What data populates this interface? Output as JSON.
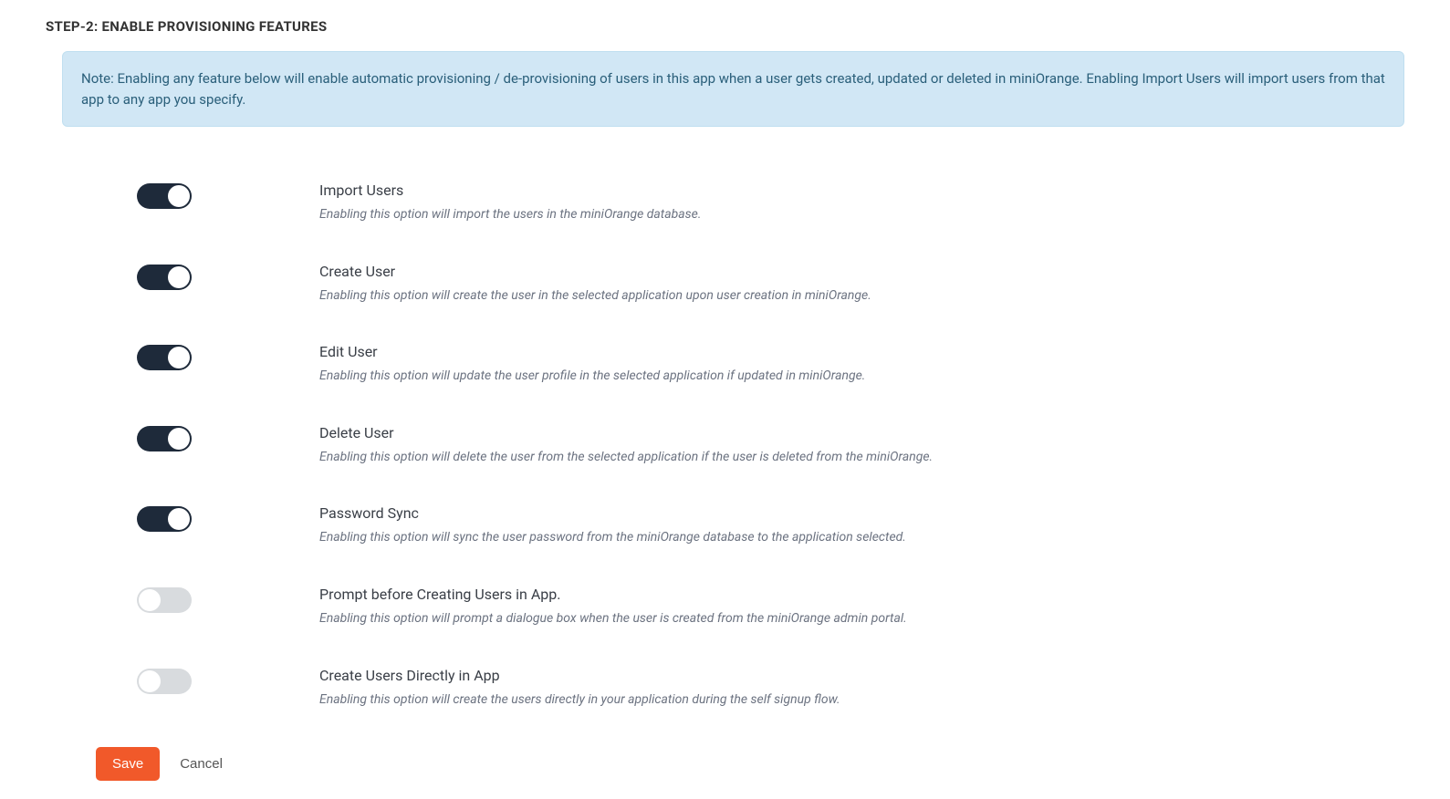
{
  "step_title": "STEP-2: ENABLE PROVISIONING FEATURES",
  "note": "Note: Enabling any feature below will enable automatic provisioning / de-provisioning of users in this app when a user gets created, updated or deleted in miniOrange. Enabling Import Users will import users from that app to any app you specify.",
  "features": [
    {
      "title": "Import Users",
      "desc": "Enabling this option will import the users in the miniOrange database.",
      "enabled": true
    },
    {
      "title": "Create User",
      "desc": "Enabling this option will create the user in the selected application upon user creation in miniOrange.",
      "enabled": true
    },
    {
      "title": "Edit User",
      "desc": "Enabling this option will update the user profile in the selected application if updated in miniOrange.",
      "enabled": true
    },
    {
      "title": "Delete User",
      "desc": "Enabling this option will delete the user from the selected application if the user is deleted from the miniOrange.",
      "enabled": true
    },
    {
      "title": "Password Sync",
      "desc": "Enabling this option will sync the user password from the miniOrange database to the application selected.",
      "enabled": true
    },
    {
      "title": "Prompt before Creating Users in App.",
      "desc": "Enabling this option will prompt a dialogue box when the user is created from the miniOrange admin portal.",
      "enabled": false
    },
    {
      "title": "Create Users Directly in App",
      "desc": "Enabling this option will create the users directly in your application during the self signup flow.",
      "enabled": false
    }
  ],
  "actions": {
    "save": "Save",
    "cancel": "Cancel"
  }
}
